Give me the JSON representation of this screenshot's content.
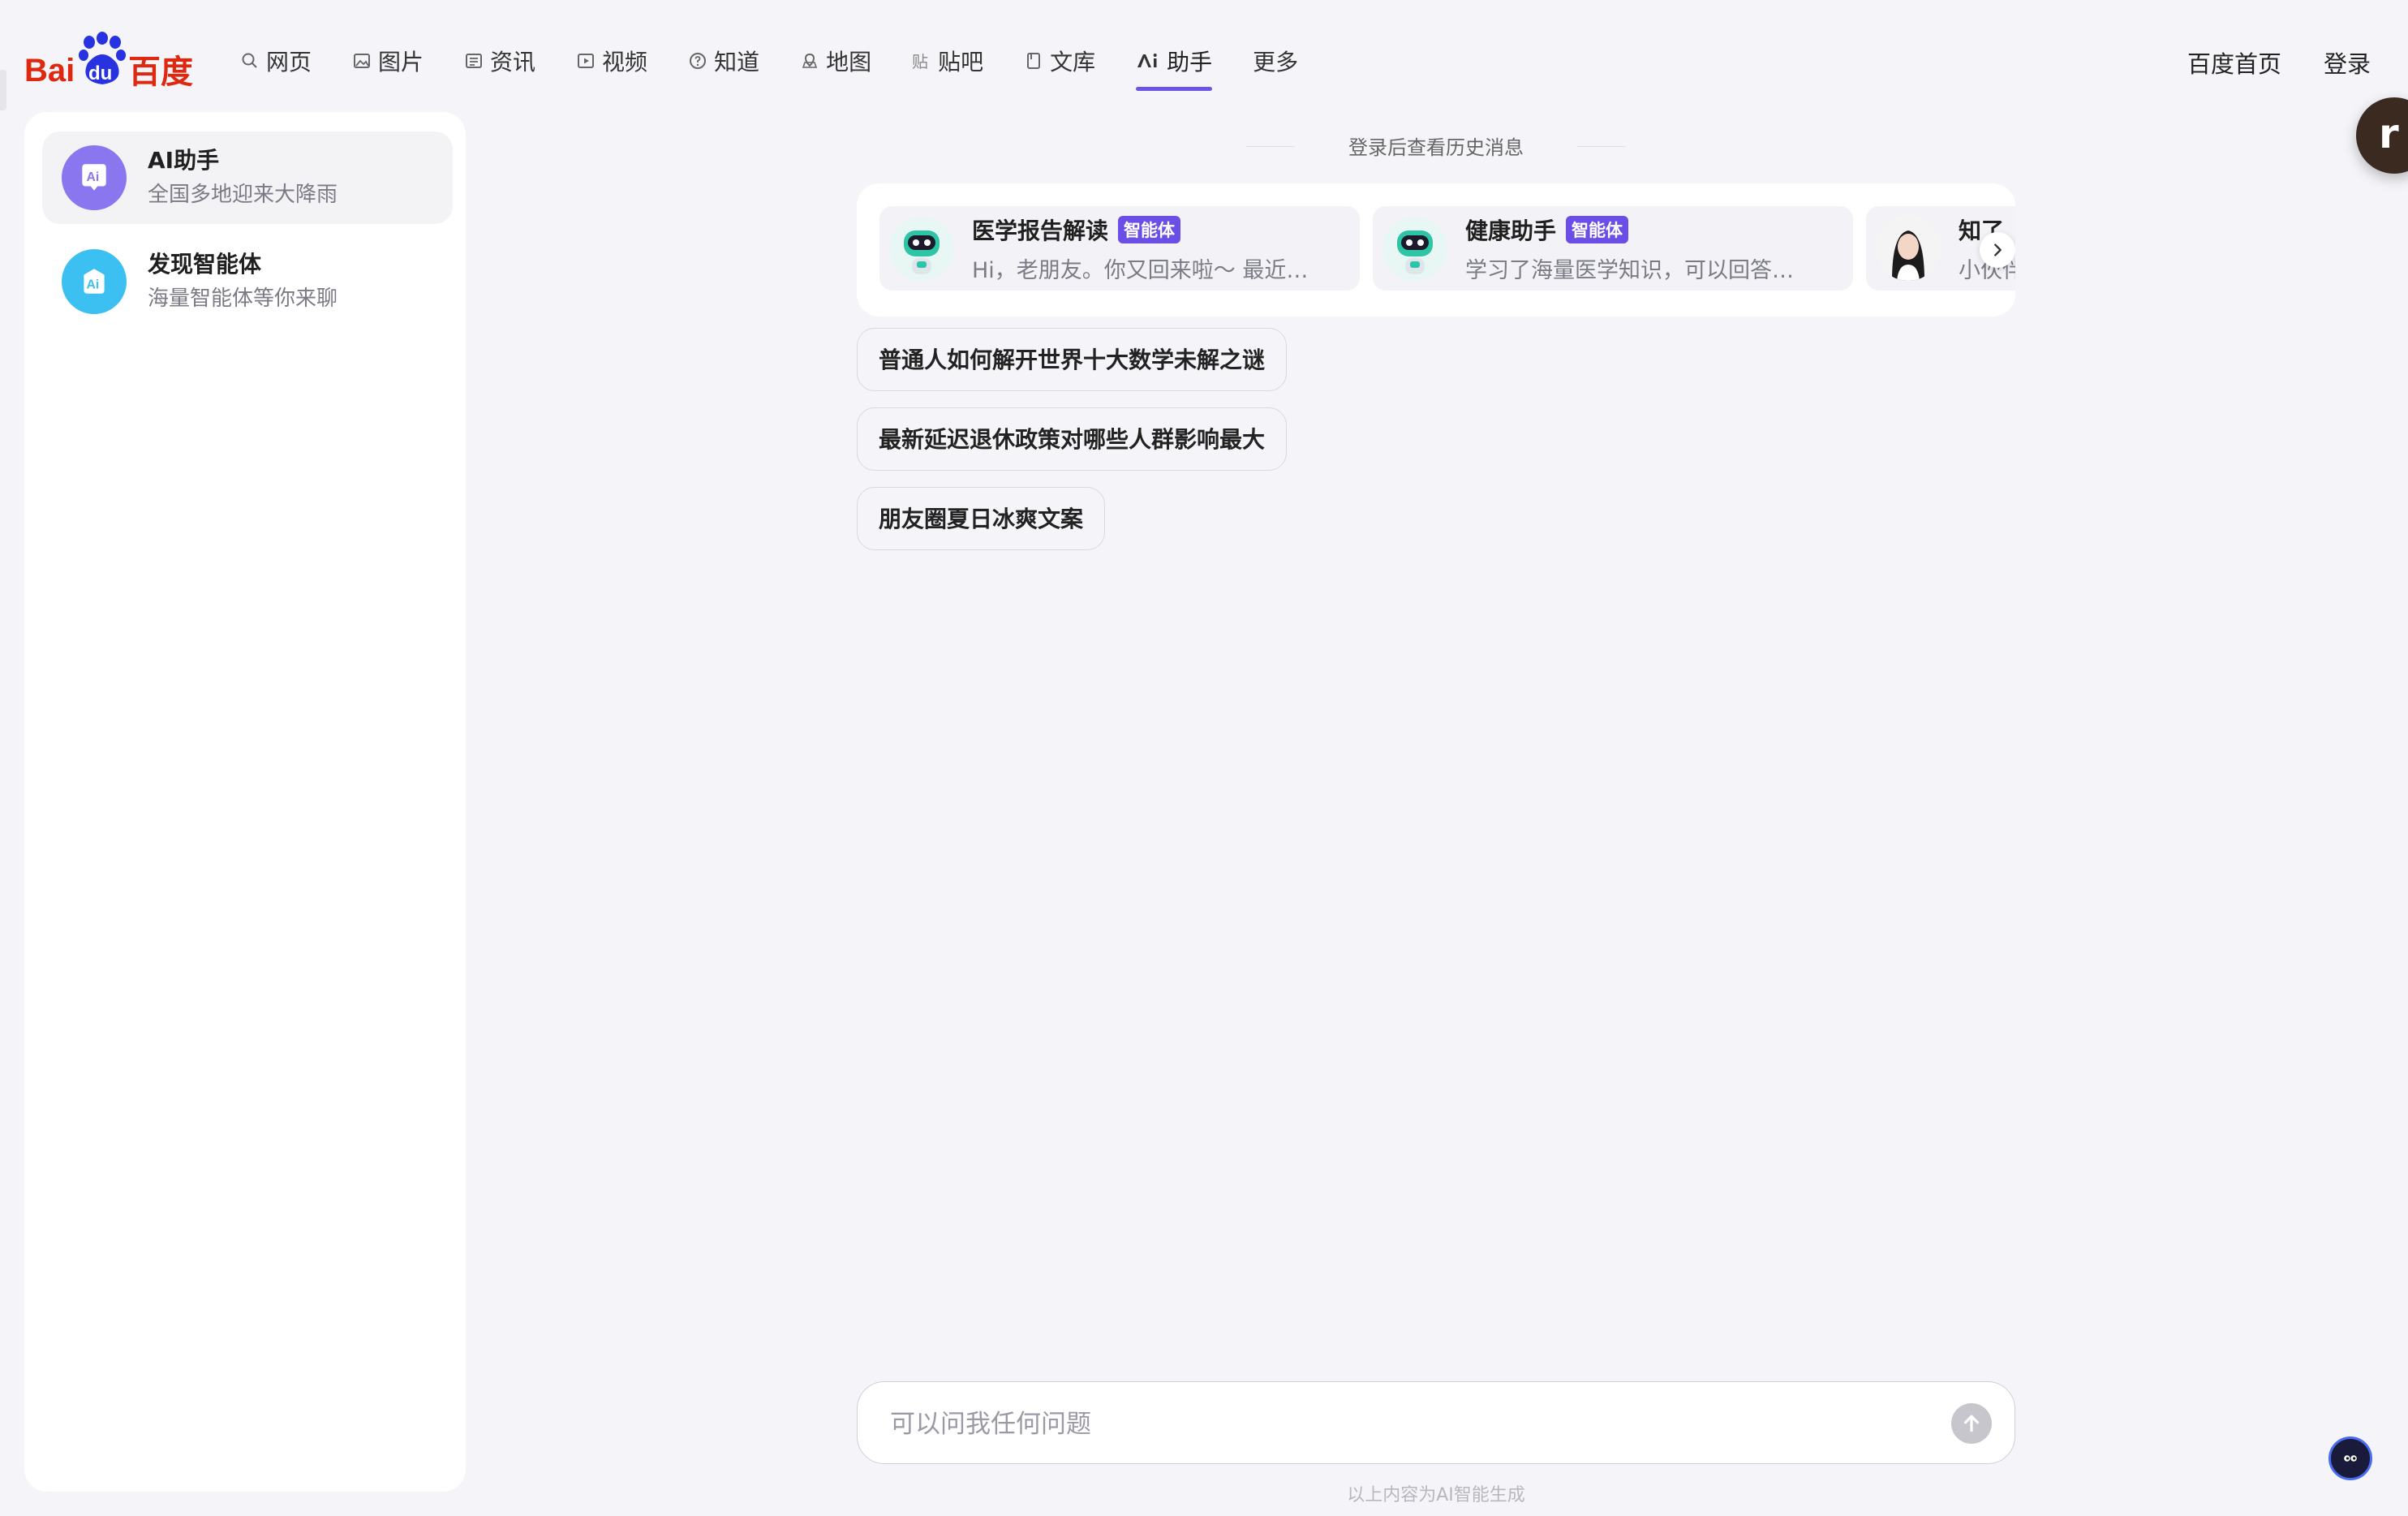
{
  "header": {
    "logo": {
      "text_bai": "Bai",
      "text_du": "du",
      "text_cn": "百度"
    },
    "nav": [
      {
        "label": "网页",
        "icon": "search-icon"
      },
      {
        "label": "图片",
        "icon": "image-icon"
      },
      {
        "label": "资讯",
        "icon": "news-icon"
      },
      {
        "label": "视频",
        "icon": "video-icon"
      },
      {
        "label": "知道",
        "icon": "question-icon"
      },
      {
        "label": "地图",
        "icon": "map-icon"
      },
      {
        "label": "贴吧",
        "icon": "tieba-icon"
      },
      {
        "label": "文库",
        "icon": "doc-icon"
      },
      {
        "label": "助手",
        "icon": "ai-icon",
        "active": true
      },
      {
        "label": "更多"
      }
    ],
    "right": {
      "home": "百度首页",
      "login": "登录"
    }
  },
  "sidebar": {
    "items": [
      {
        "title": "AI助手",
        "subtitle": "全国多地迎来大降雨",
        "icon": "ai-assistant-icon",
        "active": true
      },
      {
        "title": "发现智能体",
        "subtitle": "海量智能体等你来聊",
        "icon": "discover-agent-icon"
      }
    ]
  },
  "main": {
    "history_tip": "登录后查看历史消息",
    "agents": [
      {
        "name": "医学报告解读",
        "badge": "智能体",
        "desc": "Hi，老朋友。你又回来啦～ 最近…",
        "avatar": "robot-avatar"
      },
      {
        "name": "健康助手",
        "badge": "智能体",
        "desc": "学习了海量医学知识，可以回答…",
        "avatar": "robot-avatar"
      },
      {
        "name": "知了",
        "desc": "小伙伴",
        "avatar": "woman-avatar"
      }
    ],
    "suggestions": [
      "普通人如何解开世界十大数学未解之谜",
      "最新延迟退休政策对哪些人群影响最大",
      "朋友圈夏日冰爽文案"
    ],
    "input_placeholder": "可以问我任何问题",
    "disclaimer": "以上内容为AI智能生成"
  },
  "colors": {
    "accent": "#6b54e8",
    "logo_red": "#de2910",
    "logo_blue": "#2932e1"
  }
}
